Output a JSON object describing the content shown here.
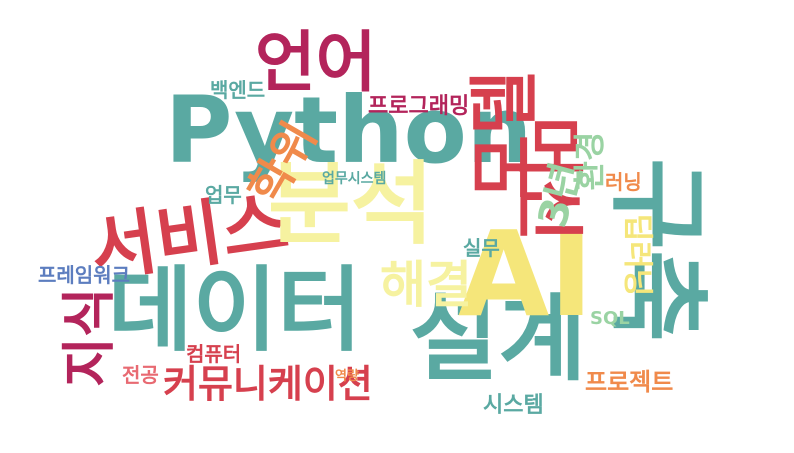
{
  "palette": {
    "teal": "#5aa9a2",
    "red": "#d6404e",
    "crimson": "#b3245b",
    "orange": "#f08a4b",
    "yellow": "#f5e67a",
    "lightyellow": "#f6f2a0",
    "green": "#9ad3a3",
    "blue": "#5c7dbf",
    "pink": "#e86a72"
  },
  "words": [
    {
      "text": "Python",
      "color": "teal"
    },
    {
      "text": "언어",
      "color": "crimson"
    },
    {
      "text": "데이터",
      "color": "teal"
    },
    {
      "text": "서비스",
      "color": "red"
    },
    {
      "text": "설계",
      "color": "teal"
    },
    {
      "text": "AI",
      "color": "yellow"
    },
    {
      "text": "분석",
      "color": "lightyellow"
    },
    {
      "text": "구축",
      "color": "teal"
    },
    {
      "text": "커뮤니케이션",
      "color": "red"
    },
    {
      "text": "딥러닝",
      "color": "yellow"
    },
    {
      "text": "해결",
      "color": "lightyellow"
    },
    {
      "text": "지식",
      "color": "crimson"
    },
    {
      "text": "머신",
      "color": "red"
    },
    {
      "text": "모델",
      "color": "red"
    },
    {
      "text": "프로그래밍",
      "color": "crimson"
    },
    {
      "text": "프로젝트",
      "color": "orange"
    },
    {
      "text": "시스템",
      "color": "teal"
    },
    {
      "text": "실무",
      "color": "teal"
    },
    {
      "text": "3년",
      "color": "green"
    },
    {
      "text": "학위",
      "color": "orange"
    },
    {
      "text": "환경",
      "color": "green"
    },
    {
      "text": "프레임워크",
      "color": "blue"
    },
    {
      "text": "업무",
      "color": "teal"
    },
    {
      "text": "전공",
      "color": "pink"
    },
    {
      "text": "컴퓨터",
      "color": "red"
    },
    {
      "text": "백엔드",
      "color": "teal"
    },
    {
      "text": "러닝",
      "color": "orange"
    },
    {
      "text": "SQL",
      "color": "green"
    },
    {
      "text": "역량",
      "color": "orange"
    },
    {
      "text": "업무시스템",
      "color": "teal"
    }
  ]
}
